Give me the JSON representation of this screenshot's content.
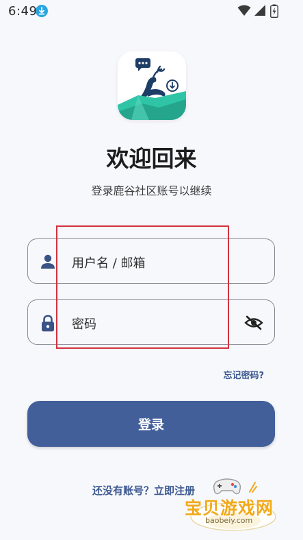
{
  "status_bar": {
    "time": "6:49",
    "icons": [
      "download-icon",
      "wifi-icon",
      "signal-icon",
      "battery-icon"
    ]
  },
  "header": {
    "title": "欢迎回来",
    "subtitle": "登录鹿谷社区账号以继续"
  },
  "form": {
    "username_placeholder": "用户名 / 邮箱",
    "password_placeholder": "密码",
    "forgot_label": "忘记密码?",
    "login_label": "登录",
    "register_label": "还没有账号？立即注册"
  },
  "watermark": {
    "text": "宝贝游戏网",
    "url": "baobeiy.com"
  },
  "colors": {
    "primary": "#425f9a",
    "link": "#3e5a91",
    "background": "#f7f8fc",
    "highlight_box": "#d2323e",
    "logo_teal": "#2fc4a6",
    "logo_navy": "#1c3d66"
  }
}
